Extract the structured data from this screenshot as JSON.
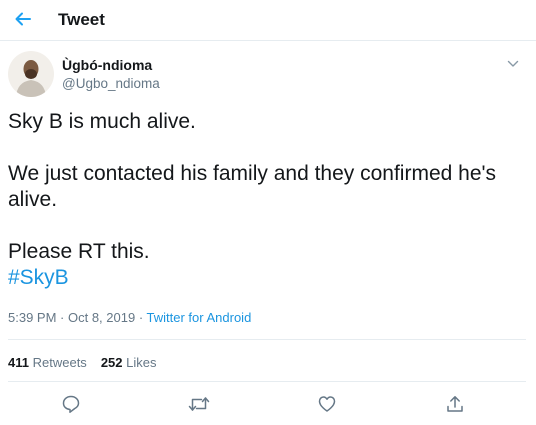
{
  "header": {
    "title": "Tweet"
  },
  "user": {
    "display_name": "Ùgbó-ndioma",
    "handle": "@Ugbo_ndioma"
  },
  "tweet": {
    "line1": "Sky B is much alive.",
    "line2": "We just contacted his family and they confirmed he's alive.",
    "line3": "Please RT this.",
    "hashtag": "#SkyB"
  },
  "meta": {
    "time": "5:39 PM",
    "separator": " · ",
    "date": "Oct 8, 2019",
    "source": "Twitter for Android"
  },
  "stats": {
    "retweets_count": "411",
    "retweets_label": "Retweets",
    "likes_count": "252",
    "likes_label": "Likes"
  },
  "actions": [
    "reply-icon",
    "retweet-icon",
    "like-icon",
    "share-icon"
  ],
  "colors": {
    "accent": "#1b95e0",
    "muted": "#657786",
    "text": "#14171a",
    "divider": "#e6ecf0"
  }
}
